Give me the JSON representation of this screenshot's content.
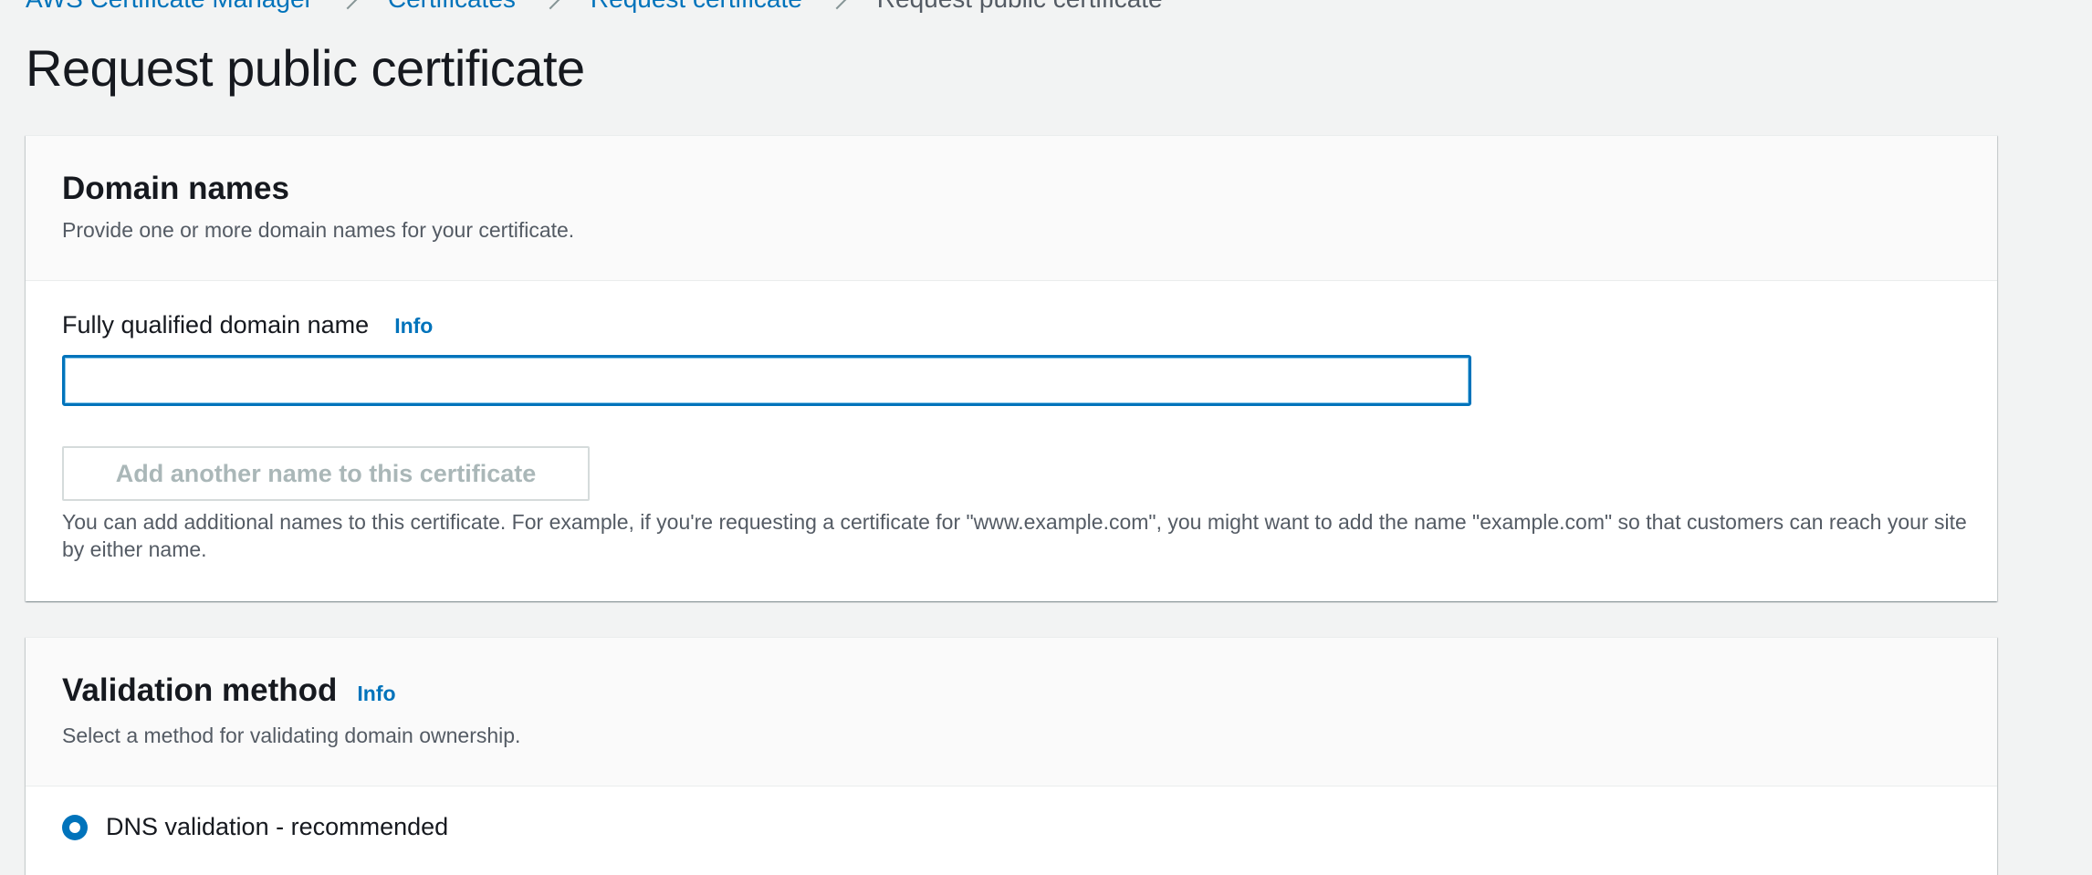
{
  "breadcrumb": {
    "items": [
      {
        "label": "AWS Certificate Manager"
      },
      {
        "label": "Certificates"
      },
      {
        "label": "Request certificate"
      }
    ],
    "current": "Request public certificate"
  },
  "page": {
    "title": "Request public certificate"
  },
  "domain_names": {
    "title": "Domain names",
    "description": "Provide one or more domain names for your certificate.",
    "fqdn_label": "Fully qualified domain name",
    "info_label": "Info",
    "fqdn_value": "",
    "add_button_label": "Add another name to this certificate",
    "constraint_text": "You can add additional names to this certificate. For example, if you're requesting a certificate for \"www.example.com\", you might want to add the name \"example.com\" so that customers can reach your site by either name."
  },
  "validation_method": {
    "title": "Validation method",
    "info_label": "Info",
    "description": "Select a method for validating domain ownership.",
    "options": [
      {
        "label": "DNS validation - recommended",
        "selected": true
      }
    ]
  },
  "colors": {
    "link": "#0073bb",
    "page_background": "#f2f3f3",
    "disabled_text": "#aab7b8",
    "secondary_text": "#545b64"
  }
}
